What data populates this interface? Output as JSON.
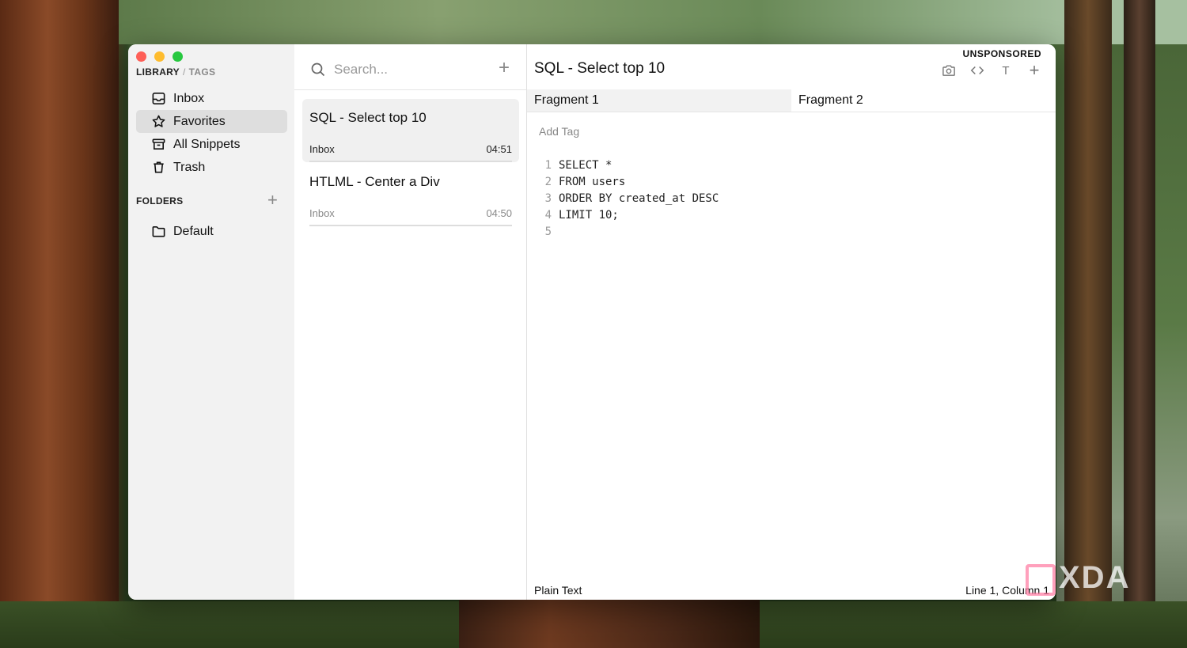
{
  "window": {
    "sidebar": {
      "library_label": "LIBRARY",
      "separator": "/",
      "tags_label": "TAGS",
      "nav_items": [
        {
          "label": "Inbox",
          "icon": "inbox-icon"
        },
        {
          "label": "Favorites",
          "icon": "star-icon",
          "active": true
        },
        {
          "label": "All Snippets",
          "icon": "archive-icon"
        },
        {
          "label": "Trash",
          "icon": "trash-icon"
        }
      ],
      "folders_label": "FOLDERS",
      "folders_add": "+",
      "folders": [
        {
          "label": "Default",
          "icon": "folder-icon"
        }
      ]
    },
    "list": {
      "search_placeholder": "Search...",
      "add": "+",
      "snippets": [
        {
          "title": "SQL - Select top 10",
          "folder": "Inbox",
          "time": "04:51",
          "active": true
        },
        {
          "title": "HTLML - Center a Div",
          "folder": "Inbox",
          "time": "04:50"
        }
      ]
    },
    "editor": {
      "badge": "UNSPONSORED",
      "title": "SQL - Select top 10",
      "tools": [
        "camera-icon",
        "code-icon",
        "text-icon",
        "plus-icon"
      ],
      "tool_text": "T",
      "tool_plus": "+",
      "fragments": [
        "Fragment 1",
        "Fragment 2"
      ],
      "add_tag": "Add Tag",
      "code_lines": [
        {
          "n": "1",
          "text": "SELECT *"
        },
        {
          "n": "2",
          "text": "FROM users"
        },
        {
          "n": "3",
          "text": "ORDER BY created_at DESC"
        },
        {
          "n": "4",
          "text": "LIMIT 10;"
        },
        {
          "n": "5",
          "text": ""
        }
      ],
      "language": "Plain Text",
      "cursor": "Line 1, Column 1"
    }
  },
  "watermark": "XDA"
}
